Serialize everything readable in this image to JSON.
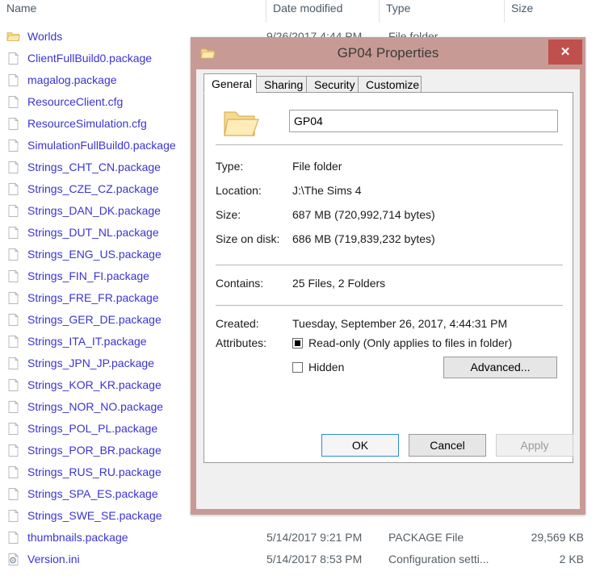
{
  "explorer": {
    "columns": [
      {
        "label": "Name"
      },
      {
        "label": "Date modified"
      },
      {
        "label": "Type"
      },
      {
        "label": "Size"
      }
    ],
    "rows": [
      {
        "name": "Worlds",
        "icon": "folder-icon",
        "date": "9/26/2017 4:44 PM",
        "type": "File folder",
        "size": ""
      },
      {
        "name": "ClientFullBuild0.package",
        "icon": "file-icon",
        "date": "",
        "type": "",
        "size": ""
      },
      {
        "name": "magalog.package",
        "icon": "file-icon",
        "date": "",
        "type": "",
        "size": ""
      },
      {
        "name": "ResourceClient.cfg",
        "icon": "file-icon",
        "date": "",
        "type": "",
        "size": ""
      },
      {
        "name": "ResourceSimulation.cfg",
        "icon": "file-icon",
        "date": "",
        "type": "",
        "size": ""
      },
      {
        "name": "SimulationFullBuild0.package",
        "icon": "file-icon",
        "date": "",
        "type": "",
        "size": ""
      },
      {
        "name": "Strings_CHT_CN.package",
        "icon": "file-icon",
        "date": "",
        "type": "",
        "size": ""
      },
      {
        "name": "Strings_CZE_CZ.package",
        "icon": "file-icon",
        "date": "",
        "type": "",
        "size": ""
      },
      {
        "name": "Strings_DAN_DK.package",
        "icon": "file-icon",
        "date": "",
        "type": "",
        "size": ""
      },
      {
        "name": "Strings_DUT_NL.package",
        "icon": "file-icon",
        "date": "",
        "type": "",
        "size": ""
      },
      {
        "name": "Strings_ENG_US.package",
        "icon": "file-icon",
        "date": "",
        "type": "",
        "size": ""
      },
      {
        "name": "Strings_FIN_FI.package",
        "icon": "file-icon",
        "date": "",
        "type": "",
        "size": ""
      },
      {
        "name": "Strings_FRE_FR.package",
        "icon": "file-icon",
        "date": "",
        "type": "",
        "size": ""
      },
      {
        "name": "Strings_GER_DE.package",
        "icon": "file-icon",
        "date": "",
        "type": "",
        "size": ""
      },
      {
        "name": "Strings_ITA_IT.package",
        "icon": "file-icon",
        "date": "",
        "type": "",
        "size": ""
      },
      {
        "name": "Strings_JPN_JP.package",
        "icon": "file-icon",
        "date": "",
        "type": "",
        "size": ""
      },
      {
        "name": "Strings_KOR_KR.package",
        "icon": "file-icon",
        "date": "",
        "type": "",
        "size": ""
      },
      {
        "name": "Strings_NOR_NO.package",
        "icon": "file-icon",
        "date": "",
        "type": "",
        "size": ""
      },
      {
        "name": "Strings_POL_PL.package",
        "icon": "file-icon",
        "date": "",
        "type": "",
        "size": ""
      },
      {
        "name": "Strings_POR_BR.package",
        "icon": "file-icon",
        "date": "",
        "type": "",
        "size": ""
      },
      {
        "name": "Strings_RUS_RU.package",
        "icon": "file-icon",
        "date": "",
        "type": "",
        "size": ""
      },
      {
        "name": "Strings_SPA_ES.package",
        "icon": "file-icon",
        "date": "",
        "type": "",
        "size": ""
      },
      {
        "name": "Strings_SWE_SE.package",
        "icon": "file-icon",
        "date": "",
        "type": "",
        "size": ""
      },
      {
        "name": "thumbnails.package",
        "icon": "file-icon",
        "date": "5/14/2017 9:21 PM",
        "type": "PACKAGE File",
        "size": "29,569 KB"
      },
      {
        "name": "Version.ini",
        "icon": "config-icon",
        "date": "5/14/2017 8:53 PM",
        "type": "Configuration setti...",
        "size": "2 KB"
      }
    ]
  },
  "dialog": {
    "title": "GP04 Properties",
    "title_icon": "folder-icon",
    "close_label": "✕",
    "tabs": [
      {
        "label": "General",
        "active": true
      },
      {
        "label": "Sharing",
        "active": false
      },
      {
        "label": "Security",
        "active": false
      },
      {
        "label": "Customize",
        "active": false
      }
    ],
    "name_value": "GP04",
    "properties": [
      {
        "label": "Type:",
        "value": "File folder"
      },
      {
        "label": "Location:",
        "value": "J:\\The Sims 4"
      },
      {
        "label": "Size:",
        "value": "687 MB (720,992,714 bytes)"
      },
      {
        "label": "Size on disk:",
        "value": "686 MB (719,839,232 bytes)"
      },
      {
        "label": "Contains:",
        "value": "25 Files, 2 Folders"
      },
      {
        "label": "Created:",
        "value": "Tuesday, September 26, 2017, 4:44:31 PM"
      }
    ],
    "attributes_label": "Attributes:",
    "readonly_label": "Read-only (Only applies to files in folder)",
    "hidden_label": "Hidden",
    "advanced_label": "Advanced...",
    "ok_label": "OK",
    "cancel_label": "Cancel",
    "apply_label": "Apply",
    "colors": {
      "titlebar": "#c89a95",
      "close": "#c0504d",
      "body": "#f0f0f0",
      "filename": "#3a34d2",
      "focus": "#2d8ad6"
    }
  }
}
